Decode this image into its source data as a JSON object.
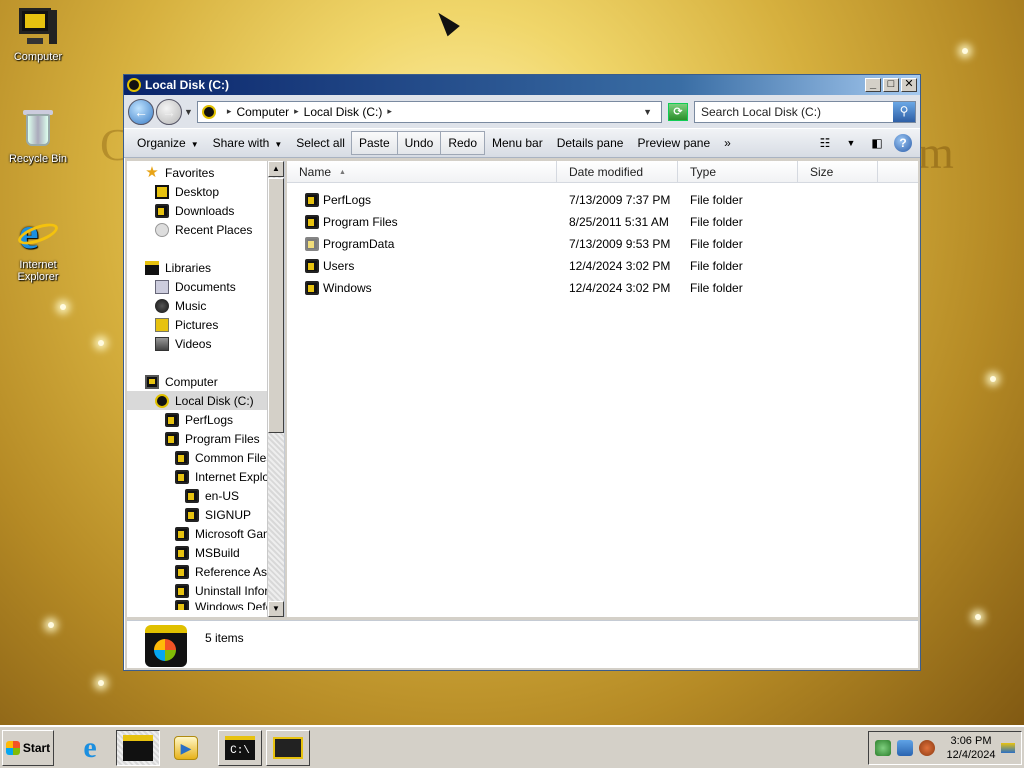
{
  "desktop": {
    "icons": [
      {
        "label": "Computer",
        "icon": "computer-icon"
      },
      {
        "label": "Recycle Bin",
        "icon": "recycle-bin-icon"
      },
      {
        "label": "Internet Explorer",
        "icon": "internet-explorer-icon"
      }
    ]
  },
  "window": {
    "title": "Local Disk (C:)",
    "controls": {
      "minimize": "_",
      "maximize": "□",
      "close": "✕"
    }
  },
  "address": {
    "crumbs": [
      "Computer",
      "Local Disk (C:)"
    ],
    "search_placeholder": "Search Local Disk (C:)"
  },
  "toolbar": {
    "organize": "Organize",
    "share_with": "Share with",
    "select_all": "Select all",
    "paste": "Paste",
    "undo": "Undo",
    "redo": "Redo",
    "menu_bar": "Menu bar",
    "details_pane": "Details pane",
    "preview_pane": "Preview pane",
    "more": "»"
  },
  "navpane": {
    "favorites": "Favorites",
    "desktop": "Desktop",
    "downloads": "Downloads",
    "recent_places": "Recent Places",
    "libraries": "Libraries",
    "documents": "Documents",
    "music": "Music",
    "pictures": "Pictures",
    "videos": "Videos",
    "computer": "Computer",
    "local_disk": "Local Disk (C:)",
    "perflogs": "PerfLogs",
    "program_files": "Program Files",
    "common_files": "Common Files",
    "internet_explorer": "Internet Explorer",
    "en_us": "en-US",
    "signup": "SIGNUP",
    "microsoft_games": "Microsoft Games",
    "msbuild": "MSBuild",
    "reference_assemblies": "Reference Assemblies",
    "uninstall_information": "Uninstall Information",
    "windows_defender": "Windows Defender"
  },
  "filelist": {
    "columns": {
      "name": "Name",
      "date_modified": "Date modified",
      "type": "Type",
      "size": "Size"
    },
    "rows": [
      {
        "name": "PerfLogs",
        "date": "7/13/2009 7:37 PM",
        "type": "File folder",
        "size": ""
      },
      {
        "name": "Program Files",
        "date": "8/25/2011 5:31 AM",
        "type": "File folder",
        "size": ""
      },
      {
        "name": "ProgramData",
        "date": "7/13/2009 9:53 PM",
        "type": "File folder",
        "size": ""
      },
      {
        "name": "Users",
        "date": "12/4/2024 3:02 PM",
        "type": "File folder",
        "size": ""
      },
      {
        "name": "Windows",
        "date": "12/4/2024 3:02 PM",
        "type": "File folder",
        "size": ""
      }
    ]
  },
  "status": {
    "item_count": "5 items"
  },
  "taskbar": {
    "start_label": "Start",
    "cmd_label": "C:\\",
    "clock_time": "3:06 PM",
    "clock_date": "12/4/2024"
  },
  "colors": {
    "accent": "#e7c20f",
    "titlebar": "#0a246a",
    "selection": "#d9d9d9"
  }
}
